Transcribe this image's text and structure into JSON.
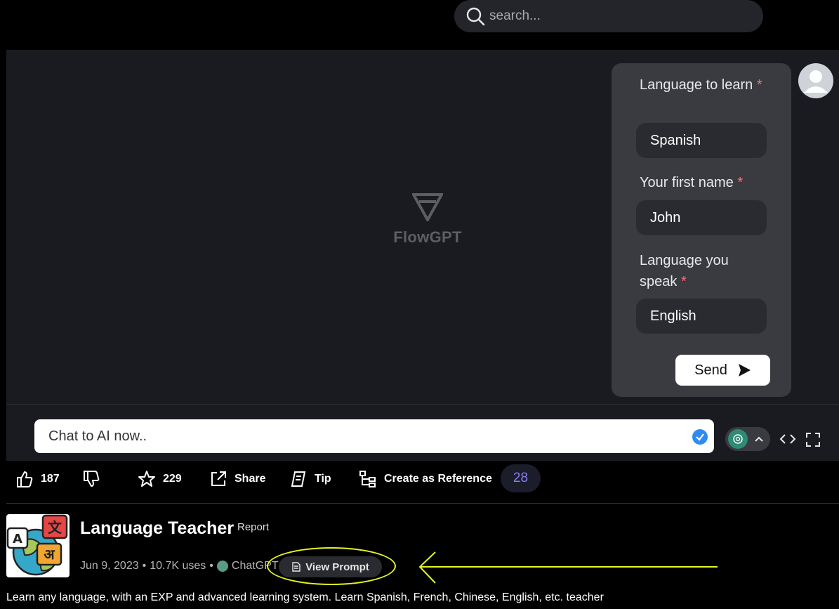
{
  "search": {
    "placeholder": "search..."
  },
  "brand": {
    "name": "FlowGPT"
  },
  "form": {
    "fields": [
      {
        "label": "Language to learn",
        "required_mark": "*",
        "value": "Spanish"
      },
      {
        "label": "Your first name",
        "required_mark": "*",
        "value": "John"
      },
      {
        "label": "Language you speak",
        "required_mark": "*",
        "value": "English"
      }
    ],
    "send_label": "Send"
  },
  "chat": {
    "placeholder": "Chat to AI now.."
  },
  "actions": {
    "likes": "187",
    "stars": "229",
    "share": "Share",
    "tip": "Tip",
    "reference": "Create as Reference",
    "count": "28"
  },
  "prompt": {
    "title": "Language Teacher",
    "report": "Report",
    "date": "Jun 9, 2023",
    "uses": "10.7K uses",
    "separator": "•",
    "model": "ChatGPT",
    "view_prompt": "View Prompt",
    "description": "Learn any language, with an EXP and advanced learning system. Learn Spanish, French, Chinese, English, etc. teacher"
  },
  "thumbnail": {
    "glyph_a": "A",
    "glyph_zh": "文",
    "glyph_hi": "अ"
  },
  "colors": {
    "accent": "#8b7cf6",
    "annotation": "#e5f51e",
    "required": "#f87171",
    "panel": "#1a1b20",
    "card": "#3a3b40"
  }
}
